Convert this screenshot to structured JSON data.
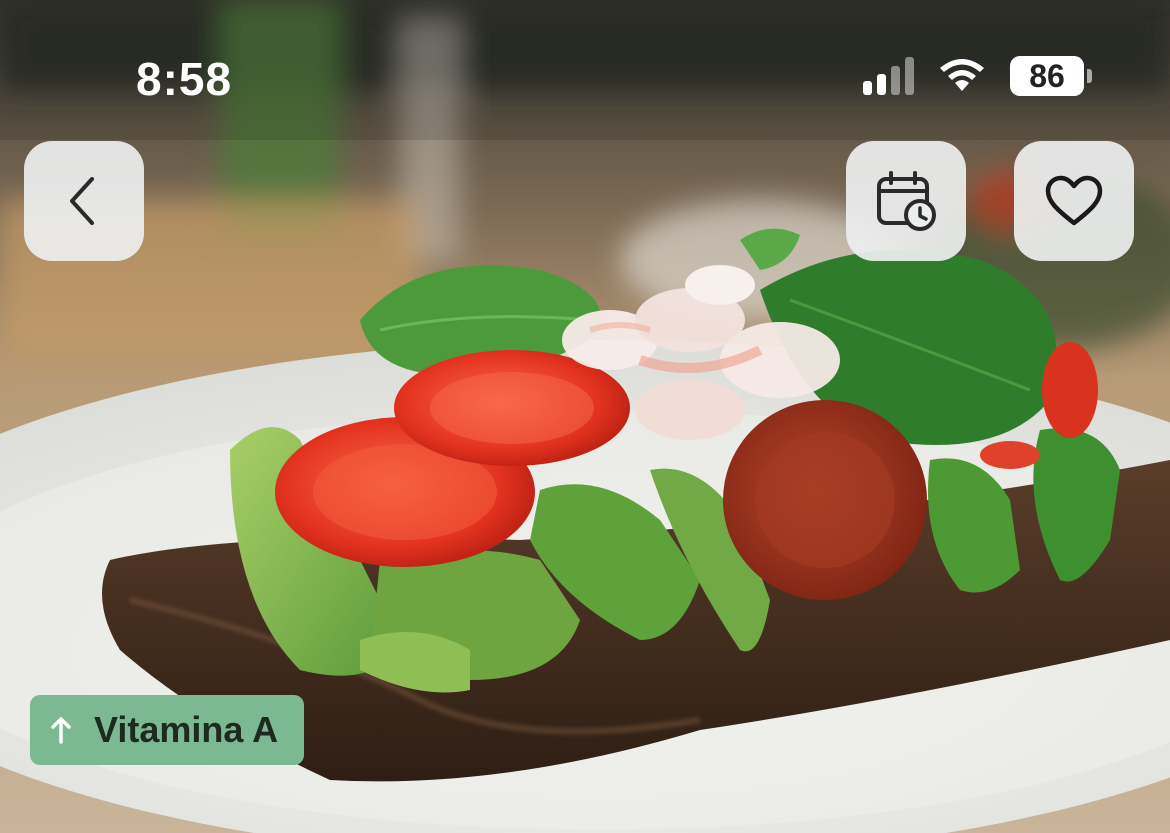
{
  "status_bar": {
    "time": "8:58",
    "battery": "86",
    "icons": [
      "cellular-signal-icon",
      "wifi-icon",
      "battery-icon"
    ]
  },
  "header": {
    "back_icon": "chevron-left-icon",
    "schedule_icon": "calendar-clock-icon",
    "favorite_icon": "heart-outline-icon"
  },
  "hero": {
    "image": "open-faced-sandwich-photo"
  },
  "nutrient_tag": {
    "label": "Vitamina A",
    "icon": "arrow-up-icon",
    "color": "#7cb891"
  }
}
